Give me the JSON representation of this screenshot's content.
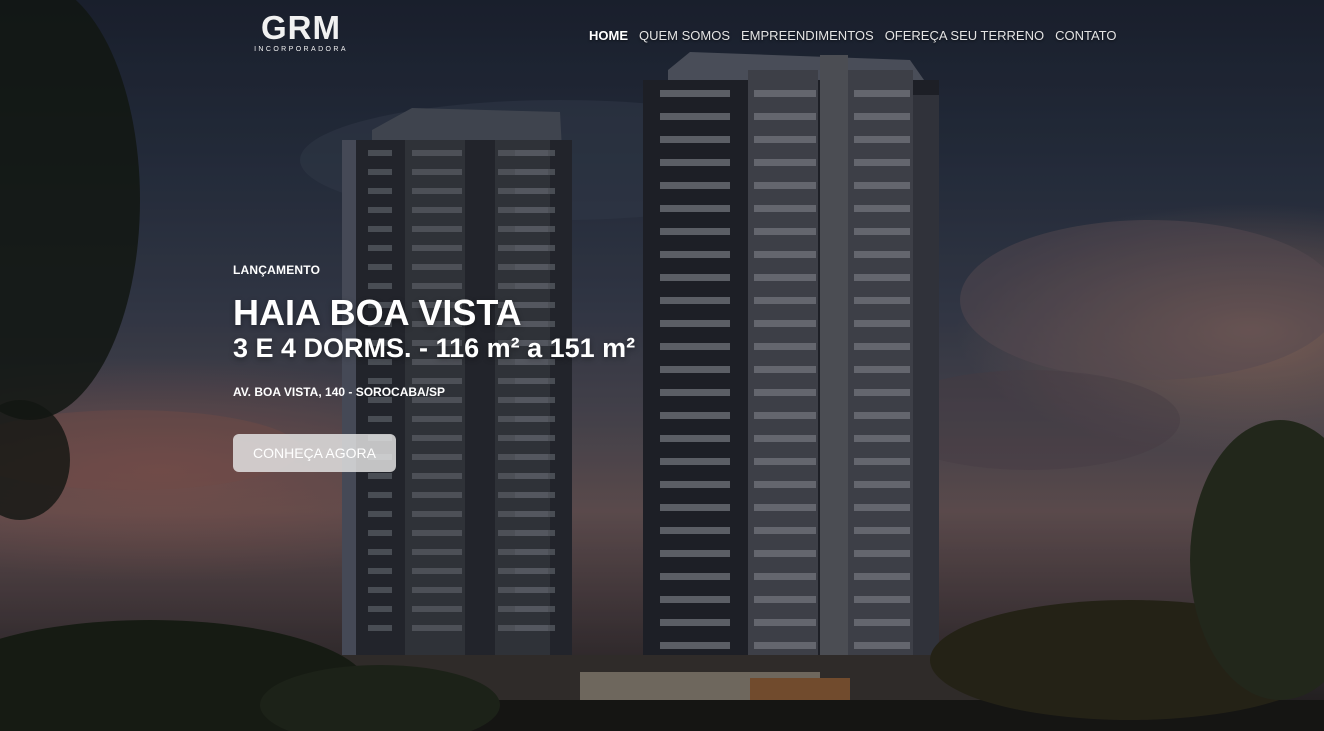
{
  "brand": {
    "name": "GRM",
    "tagline": "INCORPORADORA"
  },
  "nav": {
    "items": [
      {
        "label": "HOME",
        "active": true
      },
      {
        "label": "QUEM SOMOS"
      },
      {
        "label": "EMPREENDIMENTOS"
      },
      {
        "label": "OFEREÇA SEU TERRENO"
      },
      {
        "label": "CONTATO"
      }
    ]
  },
  "hero": {
    "eyebrow": "LANÇAMENTO",
    "title": "HAIA BOA VISTA",
    "subtitle": "3 E 4 DORMS. - 116 m² a 151 m²",
    "address": "AV. BOA VISTA, 140 - SOROCABA/SP",
    "cta_label": "CONHEÇA AGORA",
    "background": "building-rendering-at-dusk"
  },
  "colors": {
    "text": "#ffffff",
    "button_bg": "#e6e6e6"
  }
}
